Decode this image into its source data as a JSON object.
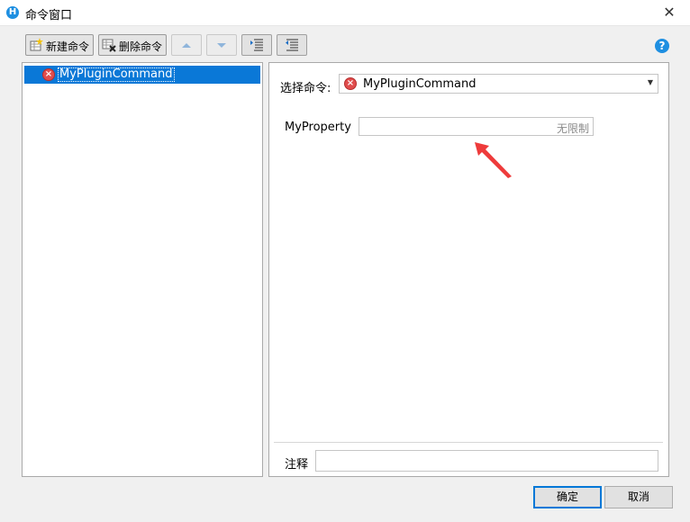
{
  "window": {
    "title": "命令窗口",
    "app_icon_letter": "H",
    "close_glyph": "✕"
  },
  "toolbar": {
    "new_label": "新建命令",
    "delete_label": "删除命令",
    "help_glyph": "?"
  },
  "tree": {
    "items": [
      {
        "label": "MyPluginCommand",
        "selected": true,
        "status": "error"
      }
    ]
  },
  "editor": {
    "select_label": "选择命令:",
    "selected_command": "MyPluginCommand",
    "property_label": "MyProperty",
    "property_placeholder": "无限制",
    "note_label": "注释",
    "note_value": ""
  },
  "footer": {
    "ok_label": "确定",
    "cancel_label": "取消"
  },
  "colors": {
    "selection": "#0a78d7",
    "accent": "#1e8fe1",
    "error": "#e04d4d",
    "annotation_arrow": "#ee3b3b"
  },
  "icons": {
    "new": "new-command-icon",
    "delete": "delete-command-icon",
    "up": "move-up-icon",
    "down": "move-down-icon",
    "indent": "indent-icon",
    "outdent": "outdent-icon",
    "help": "help-icon",
    "error": "error-icon"
  }
}
